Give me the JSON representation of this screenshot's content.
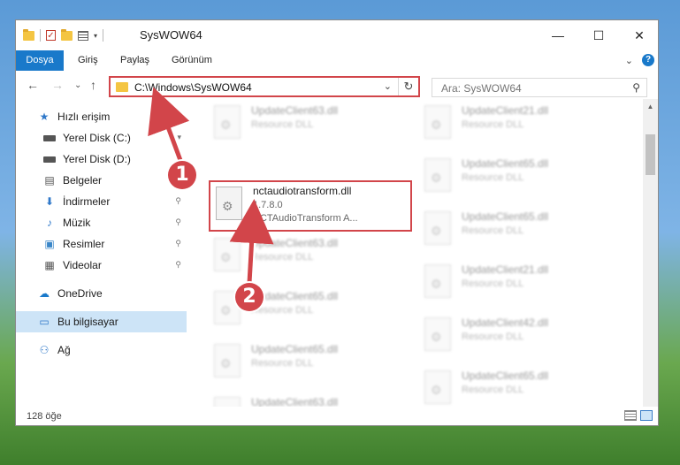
{
  "window": {
    "title": "SysWOW64",
    "controls": {
      "minimize": "—",
      "maximize": "☐",
      "close": "✕"
    }
  },
  "ribbon": {
    "tabs": [
      "Dosya",
      "Giriş",
      "Paylaş",
      "Görünüm"
    ],
    "expand_icon": "⌄",
    "help_icon": "?"
  },
  "nav": {
    "back": "←",
    "forward": "→",
    "recent": "⌄",
    "up": "↑"
  },
  "address": {
    "path": "C:\\Windows\\SysWOW64",
    "chevron": "⌄",
    "refresh": "↻"
  },
  "search": {
    "placeholder": "Ara: SysWOW64",
    "icon": "⚲"
  },
  "sidebar": {
    "items": [
      {
        "label": "Hızlı erişim",
        "icon": "★",
        "pinned": false
      },
      {
        "label": "Yerel Disk (C:)",
        "icon": "drive",
        "pinned": true
      },
      {
        "label": "Yerel Disk (D:)",
        "icon": "drive",
        "pinned": true
      },
      {
        "label": "Belgeler",
        "icon": "▤",
        "pinned": true
      },
      {
        "label": "İndirmeler",
        "icon": "⬇",
        "pinned": true
      },
      {
        "label": "Müzik",
        "icon": "♪",
        "pinned": true
      },
      {
        "label": "Resimler",
        "icon": "▣",
        "pinned": true
      },
      {
        "label": "Videolar",
        "icon": "▦",
        "pinned": true
      },
      {
        "label": "OneDrive",
        "icon": "☁",
        "pinned": false
      },
      {
        "label": "Bu bilgisayar",
        "icon": "▭",
        "pinned": false,
        "selected": true
      },
      {
        "label": "Ağ",
        "icon": "⚇",
        "pinned": false
      }
    ],
    "pin_icon": "📌"
  },
  "files": {
    "left_column": [
      {
        "name": "UpdateClient63.dll",
        "type": "Resource DLL"
      },
      {
        "name": "nctaudiotransform.dll",
        "version": "1.7.8.0",
        "description": "NCTAudioTransform A..."
      },
      {
        "name": "UpdateClient63.dll",
        "type": "Resource DLL"
      },
      {
        "name": "UpdateClient65.dll",
        "type": "Resource DLL"
      },
      {
        "name": "UpdateClient65.dll",
        "type": "Resource DLL"
      },
      {
        "name": "UpdateClient63.dll",
        "type": "Resource DLL"
      }
    ],
    "right_column": [
      {
        "name": "UpdateClient21.dll",
        "type": "Resource DLL"
      },
      {
        "name": "UpdateClient65.dll",
        "type": "Resource DLL"
      },
      {
        "name": "UpdateClient65.dll",
        "type": "Resource DLL"
      },
      {
        "name": "UpdateClient21.dll",
        "type": "Resource DLL"
      },
      {
        "name": "UpdateClient42.dll",
        "type": "Resource DLL"
      },
      {
        "name": "UpdateClient65.dll",
        "type": "Resource DLL"
      }
    ]
  },
  "status": {
    "count": "128 öğe"
  },
  "callouts": {
    "first": "1",
    "second": "2"
  },
  "colors": {
    "accent": "#1979ca",
    "highlight": "#d2454a",
    "selected": "#cde4f7"
  }
}
